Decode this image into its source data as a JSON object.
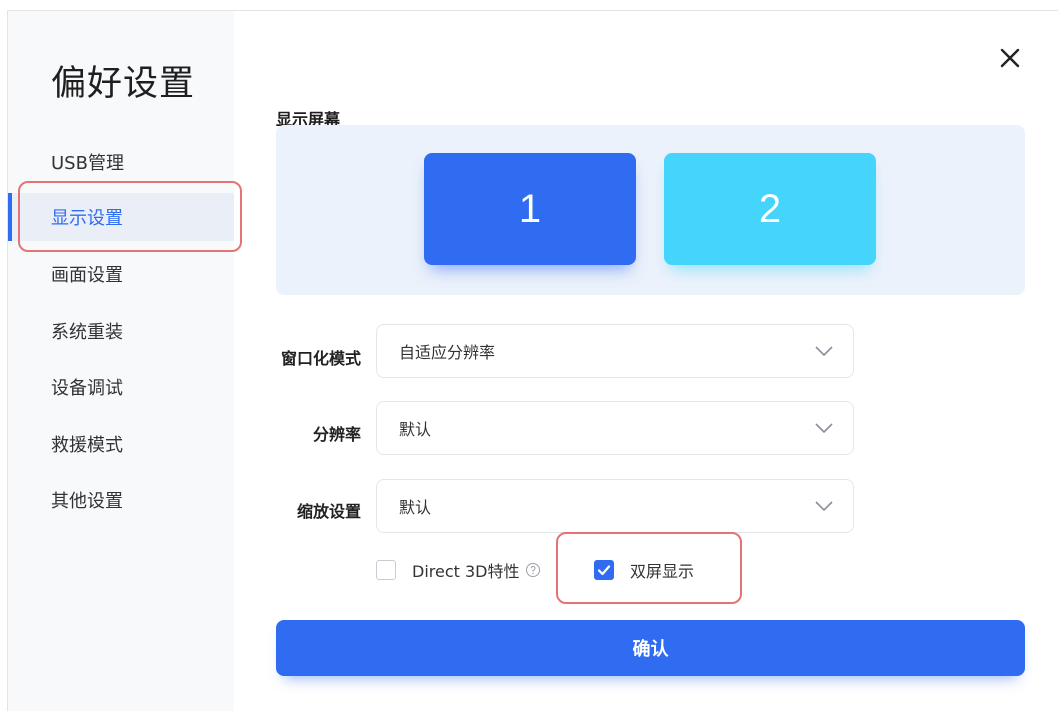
{
  "sidebar": {
    "title": "偏好设置",
    "items": [
      {
        "label": "USB管理",
        "active": false
      },
      {
        "label": "显示设置",
        "active": true
      },
      {
        "label": "画面设置",
        "active": false
      },
      {
        "label": "系统重装",
        "active": false
      },
      {
        "label": "设备调试",
        "active": false
      },
      {
        "label": "救援模式",
        "active": false
      },
      {
        "label": "其他设置",
        "active": false
      }
    ]
  },
  "main": {
    "section_title": "显示屏幕",
    "screens": [
      {
        "label": "1",
        "color": "#2f6cf2"
      },
      {
        "label": "2",
        "color": "#45d4fb"
      }
    ],
    "fields": {
      "window_mode": {
        "label": "窗口化模式",
        "value": "自适应分辨率"
      },
      "resolution": {
        "label": "分辨率",
        "value": "默认"
      },
      "scaling": {
        "label": "缩放设置",
        "value": "默认"
      }
    },
    "checkboxes": {
      "direct3d": {
        "label": "Direct 3D特性",
        "checked": false
      },
      "dual_screen": {
        "label": "双屏显示",
        "checked": true
      }
    },
    "confirm_label": "确认"
  },
  "colors": {
    "accent": "#2f6cf2",
    "secondary_screen": "#45d4fb",
    "highlight": "#e57373"
  },
  "icons": {
    "close": "close-icon",
    "dropdown": "chevron-down-icon",
    "help": "help-circle-icon",
    "check": "check-icon"
  }
}
